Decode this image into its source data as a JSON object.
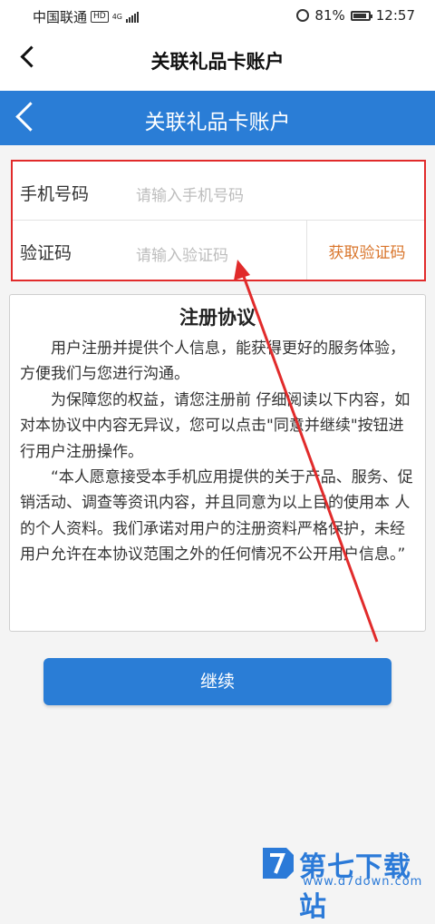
{
  "status_bar": {
    "carrier": "中国联通",
    "hd": "HD",
    "network": "4G",
    "battery": "81%",
    "time": "12:57"
  },
  "app_header": {
    "title": "关联礼品卡账户"
  },
  "blue_header": {
    "title": "关联礼品卡账户"
  },
  "form": {
    "phone": {
      "label": "手机号码",
      "placeholder": "请输入手机号码"
    },
    "code": {
      "label": "验证码",
      "placeholder": "请输入验证码"
    },
    "get_code_label": "获取验证码"
  },
  "agreement": {
    "title": "注册协议",
    "paragraphs": [
      "用户注册并提供个人信息，能获得更好的服务体验，方便我们与您进行沟通。",
      "为保障您的权益，请您注册前 仔细阅读以下内容，如对本协议中内容无异议，您可以点击\"同意并继续\"按钮进行用户注册操作。",
      "“本人愿意接受本手机应用提供的关于产品、服务、促销活动、调查等资讯内容，并且同意为以上目的使用本 人的个人资料。我们承诺对用户的注册资料严格保护，未经用户允许在本协议范围之外的任何情况不公开用户信息。”"
    ]
  },
  "continue_label": "继续",
  "watermark": {
    "name": "第七下载站",
    "url": "www.d7down.com"
  },
  "colors": {
    "primary": "#2a7dd6",
    "highlight_border": "#e12b2b",
    "link_orange": "#d9752b"
  }
}
